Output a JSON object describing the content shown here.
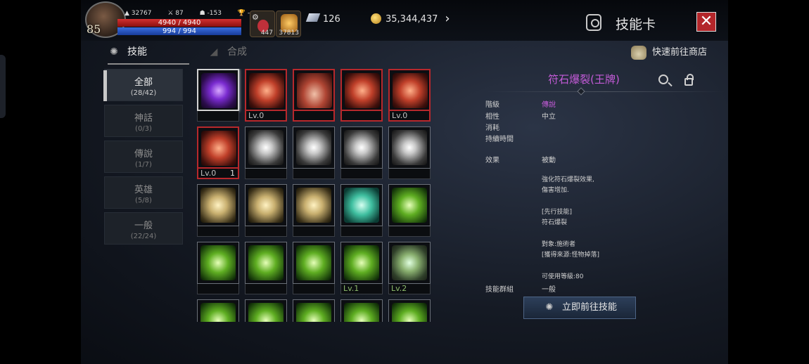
{
  "hud": {
    "level": "85",
    "stat_a": "32767",
    "stat_b": "87",
    "stat_c": "-153",
    "stat_d": "-",
    "hp": "4940 / 4940",
    "mp": "994 / 994",
    "potion1_count": "447",
    "potion2_count": "37813",
    "gems": "126",
    "gold": "35,344,437"
  },
  "window": {
    "title": "技能卡",
    "close_label": "✕"
  },
  "tabs": [
    {
      "label": "技能",
      "active": true
    },
    {
      "label": "合成",
      "active": false
    }
  ],
  "shop_link": "快速前往商店",
  "categories": [
    {
      "name": "全部",
      "count": "(28/42)",
      "active": true
    },
    {
      "name": "神話",
      "count": "(0/3)"
    },
    {
      "name": "傳說",
      "count": "(1/7)"
    },
    {
      "name": "英雄",
      "count": "(5/8)"
    },
    {
      "name": "一般",
      "count": "(22/24)"
    }
  ],
  "grid": [
    [
      {
        "icon": "rune-burst-icon",
        "level": "",
        "border": "selected"
      },
      {
        "icon": "dash-slash-icon",
        "level": "Lv.0",
        "border": "red"
      },
      {
        "icon": "body-aura-icon",
        "level": "",
        "border": "red"
      },
      {
        "icon": "axe-icon",
        "level": "",
        "border": "red"
      },
      {
        "icon": "sword-circle-icon",
        "level": "Lv.0",
        "border": "red"
      }
    ],
    [
      {
        "icon": "cross-seal-icon",
        "level": "Lv.0",
        "qty": "1",
        "border": "red"
      },
      {
        "icon": "shield-bolt-icon",
        "level": "",
        "border": "normal"
      },
      {
        "icon": "lightning-icon",
        "level": "",
        "border": "normal"
      },
      {
        "icon": "arc-arrow-icon",
        "level": "",
        "border": "normal"
      },
      {
        "icon": "star-burst-icon",
        "level": "",
        "border": "normal"
      }
    ],
    [
      {
        "icon": "summon-icon",
        "level": "",
        "border": "normal"
      },
      {
        "icon": "eye-icon",
        "level": "",
        "border": "normal"
      },
      {
        "icon": "sun-spiral-icon",
        "level": "",
        "border": "normal"
      },
      {
        "icon": "leaf-blade-icon",
        "level": "",
        "border": "normal"
      },
      {
        "icon": "green-body-icon",
        "level": "",
        "border": "normal"
      }
    ],
    [
      {
        "icon": "sprint-icon",
        "level": "",
        "border": "normal"
      },
      {
        "icon": "double-chevron-icon",
        "level": "",
        "border": "normal"
      },
      {
        "icon": "rune-swirl-icon",
        "level": "",
        "border": "normal"
      },
      {
        "icon": "green-wave-icon",
        "level": "Lv.1",
        "border": "normal"
      },
      {
        "icon": "whirl-icon",
        "level": "Lv.2",
        "border": "normal"
      }
    ],
    [
      {
        "icon": "green-crowd-icon",
        "level": "",
        "border": "normal"
      },
      {
        "icon": "green-shield-icon",
        "level": "",
        "border": "normal"
      },
      {
        "icon": "green-skull-icon",
        "level": "",
        "border": "normal"
      },
      {
        "icon": "green-beast-icon",
        "level": "",
        "border": "normal"
      },
      {
        "icon": "green-blade-icon",
        "level": "",
        "border": "normal"
      }
    ]
  ],
  "detail": {
    "title": "符石爆裂(王牌)",
    "rank_label": "階級",
    "rank_value": "傳說",
    "affinity_label": "相性",
    "affinity_value": "中立",
    "cost_label": "消耗",
    "duration_label": "持續時間",
    "effect_label": "效果",
    "effect_value": "被動",
    "desc_1": "強化符石爆裂效果,",
    "desc_2": "傷害增加.",
    "desc_3": "[先行技能]",
    "desc_4": "符石爆裂",
    "desc_5": "對象:施術者",
    "desc_6": "[獲得來源:怪物掉落]",
    "desc_7": "可使用等級:80",
    "group_label": "技能群組",
    "group_value": "一般",
    "goto_button": "立即前往技能"
  },
  "colors": {
    "legend": "#c45bd8",
    "red_frame": "#b8282c",
    "close": "#b3262a"
  }
}
